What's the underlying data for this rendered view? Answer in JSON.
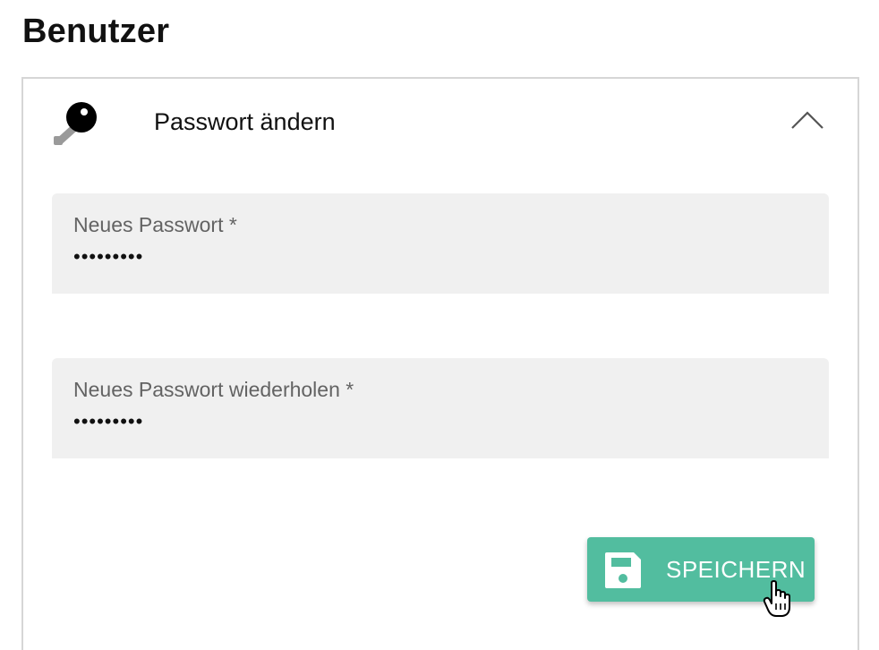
{
  "page": {
    "title": "Benutzer"
  },
  "panel": {
    "title": "Passwort ändern",
    "icon": "key-icon",
    "collapse_icon": "chevron-up-icon",
    "expanded": true
  },
  "fields": [
    {
      "label": "Neues Passwort *",
      "value": "•••••••••"
    },
    {
      "label": "Neues Passwort wiederholen *",
      "value": "•••••••••"
    }
  ],
  "save_button": {
    "label": "SPEICHERN",
    "icon": "floppy-disk-icon",
    "color": "#52bd9f"
  },
  "colors": {
    "accent": "#52bd9f",
    "field_background": "#f0f0f0",
    "panel_border": "#d6d6d6"
  }
}
